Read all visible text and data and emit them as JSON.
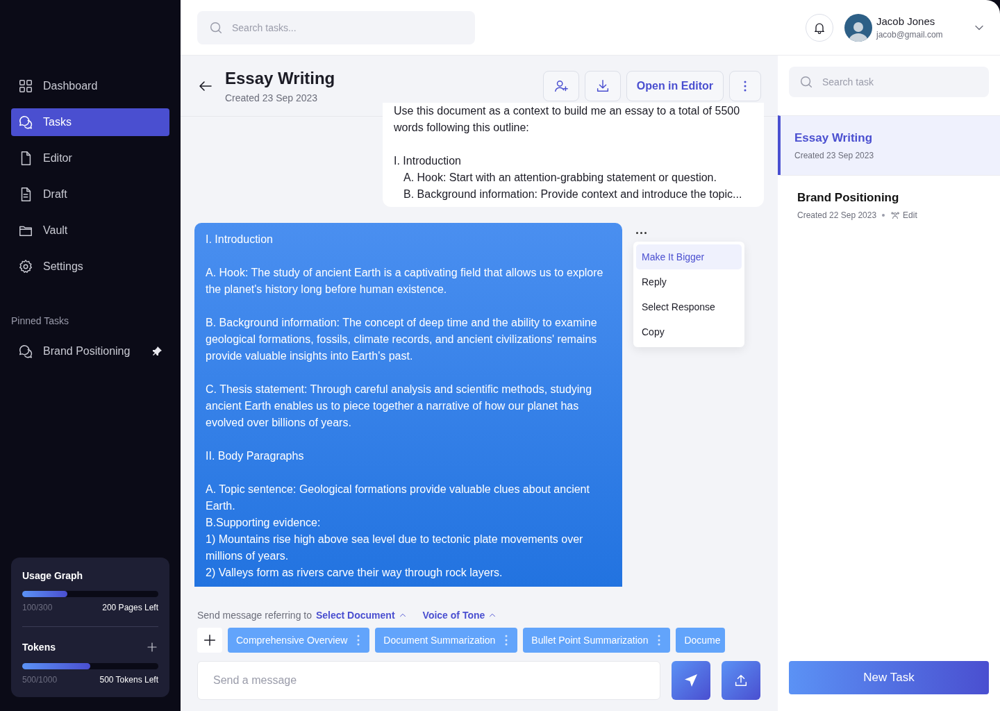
{
  "sidebar": {
    "nav": [
      {
        "label": "Dashboard",
        "selected": false
      },
      {
        "label": "Tasks",
        "selected": true
      },
      {
        "label": "Editor",
        "selected": false
      },
      {
        "label": "Draft",
        "selected": false
      },
      {
        "label": "Vault",
        "selected": false
      },
      {
        "label": "Settings",
        "selected": false
      }
    ],
    "pinned_heading": "Pinned Tasks",
    "pinned": [
      {
        "label": "Brand Positioning",
        "pinned": true
      }
    ],
    "usage": [
      {
        "title": "Usage Graph",
        "level": 0.33,
        "used": "100/300",
        "left": "200 Pages Left",
        "addable": false
      },
      {
        "title": "Tokens",
        "level": 0.5,
        "used": "500/1000",
        "left": "500 Tokens Left",
        "addable": true
      }
    ]
  },
  "topbar": {
    "search": {
      "placeholder": "Search tasks..."
    },
    "user": {
      "name": "Jacob Jones",
      "email": "jacob@gmail.com"
    }
  },
  "task": {
    "title": "Essay Writing",
    "created": "Created 23 Sep 2023",
    "open_button": "Open in Editor"
  },
  "prompt": {
    "intro": "Use this document as a context to build me an essay to a total of 5500 words following this outline:",
    "lines": [
      {
        "text": "I. Introduction",
        "indented": false
      },
      {
        "text": "A. Hook: Start with an attention-grabbing statement or question.",
        "indented": true
      },
      {
        "text": "B. Background information: Provide context and introduce the topic...",
        "indented": true
      }
    ]
  },
  "response": {
    "blocks": [
      [
        "I. Introduction"
      ],
      [
        "A. Hook: The study of ancient Earth is a captivating field that allows us to explore the planet's history long before human existence."
      ],
      [
        "B. Background information: The concept of deep time and the ability to examine geological formations, fossils, climate records, and ancient civilizations' remains provide valuable insights into Earth's past."
      ],
      [
        "C. Thesis statement: Through careful analysis and scientific methods, studying ancient Earth enables us to piece together a narrative of how our planet has evolved over billions of years."
      ],
      [
        "II. Body Paragraphs"
      ],
      [
        "A. Topic sentence: Geological formations provide valuable clues about ancient Earth.",
        "B.Supporting evidence:",
        "1) Mountains rise high above sea level due to tectonic plate movements over millions of years.",
        "2) Valleys form as rivers carve their way through rock layers."
      ]
    ]
  },
  "context_menu": {
    "items": [
      {
        "label": "Make It Bigger",
        "selected": true
      },
      {
        "label": "Reply",
        "selected": false
      },
      {
        "label": "Select Response",
        "selected": false
      },
      {
        "label": "Copy",
        "selected": false
      }
    ]
  },
  "composer": {
    "referring_label": "Send message referring to",
    "selectors": [
      "Select Document",
      "Voice of Tone"
    ],
    "chips": [
      {
        "label": "Comprehensive Overview",
        "truncated": false
      },
      {
        "label": "Document Summarization",
        "truncated": false
      },
      {
        "label": "Bullet Point Summarization",
        "truncated": false
      },
      {
        "label": "Docume",
        "truncated": true
      }
    ],
    "placeholder": "Send a message"
  },
  "task_panel": {
    "search": {
      "placeholder": "Search task"
    },
    "tasks": [
      {
        "title": "Essay Writing",
        "created": "Created 23 Sep 2023",
        "selected": true
      },
      {
        "title": "Brand Positioning",
        "created": "Created 22 Sep 2023",
        "selected": false,
        "edit_label": "Edit"
      }
    ],
    "new_button": "New Task"
  }
}
